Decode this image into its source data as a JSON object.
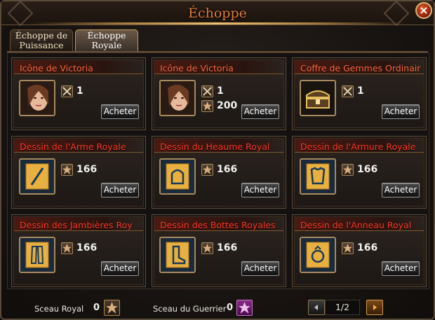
{
  "window": {
    "title": "Échoppe"
  },
  "tabs": [
    {
      "label_line1": "Échoppe de",
      "label_line2": "Puissance",
      "active": false
    },
    {
      "label_line1": "Échoppe",
      "label_line2": "Royale",
      "active": true
    }
  ],
  "items": [
    {
      "name": "Icône de Victoria",
      "icon": "victoria-portrait-icon",
      "costs": [
        {
          "currency": "crossed-swords-icon",
          "value": "1"
        }
      ],
      "buy_label": "Acheter"
    },
    {
      "name": "Icône de Victoria",
      "icon": "victoria-portrait-icon",
      "costs": [
        {
          "currency": "crossed-swords-icon",
          "value": "1"
        },
        {
          "currency": "royal-seal-icon",
          "value": "200"
        }
      ],
      "buy_label": "Acheter"
    },
    {
      "name": "Coffre de Gemmes Ordinair",
      "icon": "gem-chest-icon",
      "costs": [
        {
          "currency": "crossed-swords-icon",
          "value": "1"
        }
      ],
      "buy_label": "Acheter"
    },
    {
      "name": "Dessin de l'Arme Royale",
      "icon": "weapon-blueprint-icon",
      "costs": [
        {
          "currency": "royal-seal-icon",
          "value": "166"
        }
      ],
      "buy_label": "Acheter"
    },
    {
      "name": "Dessin du Heaume Royal",
      "icon": "helmet-blueprint-icon",
      "costs": [
        {
          "currency": "royal-seal-icon",
          "value": "166"
        }
      ],
      "buy_label": "Acheter"
    },
    {
      "name": "Dessin de l'Armure Royale",
      "icon": "armor-blueprint-icon",
      "costs": [
        {
          "currency": "royal-seal-icon",
          "value": "166"
        }
      ],
      "buy_label": "Acheter"
    },
    {
      "name": "Dessin des Jambières Roy",
      "icon": "greaves-blueprint-icon",
      "costs": [
        {
          "currency": "royal-seal-icon",
          "value": "166"
        }
      ],
      "buy_label": "Acheter"
    },
    {
      "name": "Dessin des Bottes Royales",
      "icon": "boots-blueprint-icon",
      "costs": [
        {
          "currency": "royal-seal-icon",
          "value": "166"
        }
      ],
      "buy_label": "Acheter"
    },
    {
      "name": "Dessin de l'Anneau Royal",
      "icon": "ring-blueprint-icon",
      "costs": [
        {
          "currency": "royal-seal-icon",
          "value": "166"
        }
      ],
      "buy_label": "Acheter"
    }
  ],
  "footer": {
    "royal_seal_label": "Sceau Royal",
    "royal_seal_value": "0",
    "warrior_seal_label": "Sceau du Guerrier",
    "warrior_seal_value": "0",
    "page": "1/2"
  },
  "colors": {
    "title": "#e07a3a",
    "item_name_orange": "#ff6a40",
    "item_name_red": "#ff3a2a",
    "accent_gold": "#a78a60"
  }
}
